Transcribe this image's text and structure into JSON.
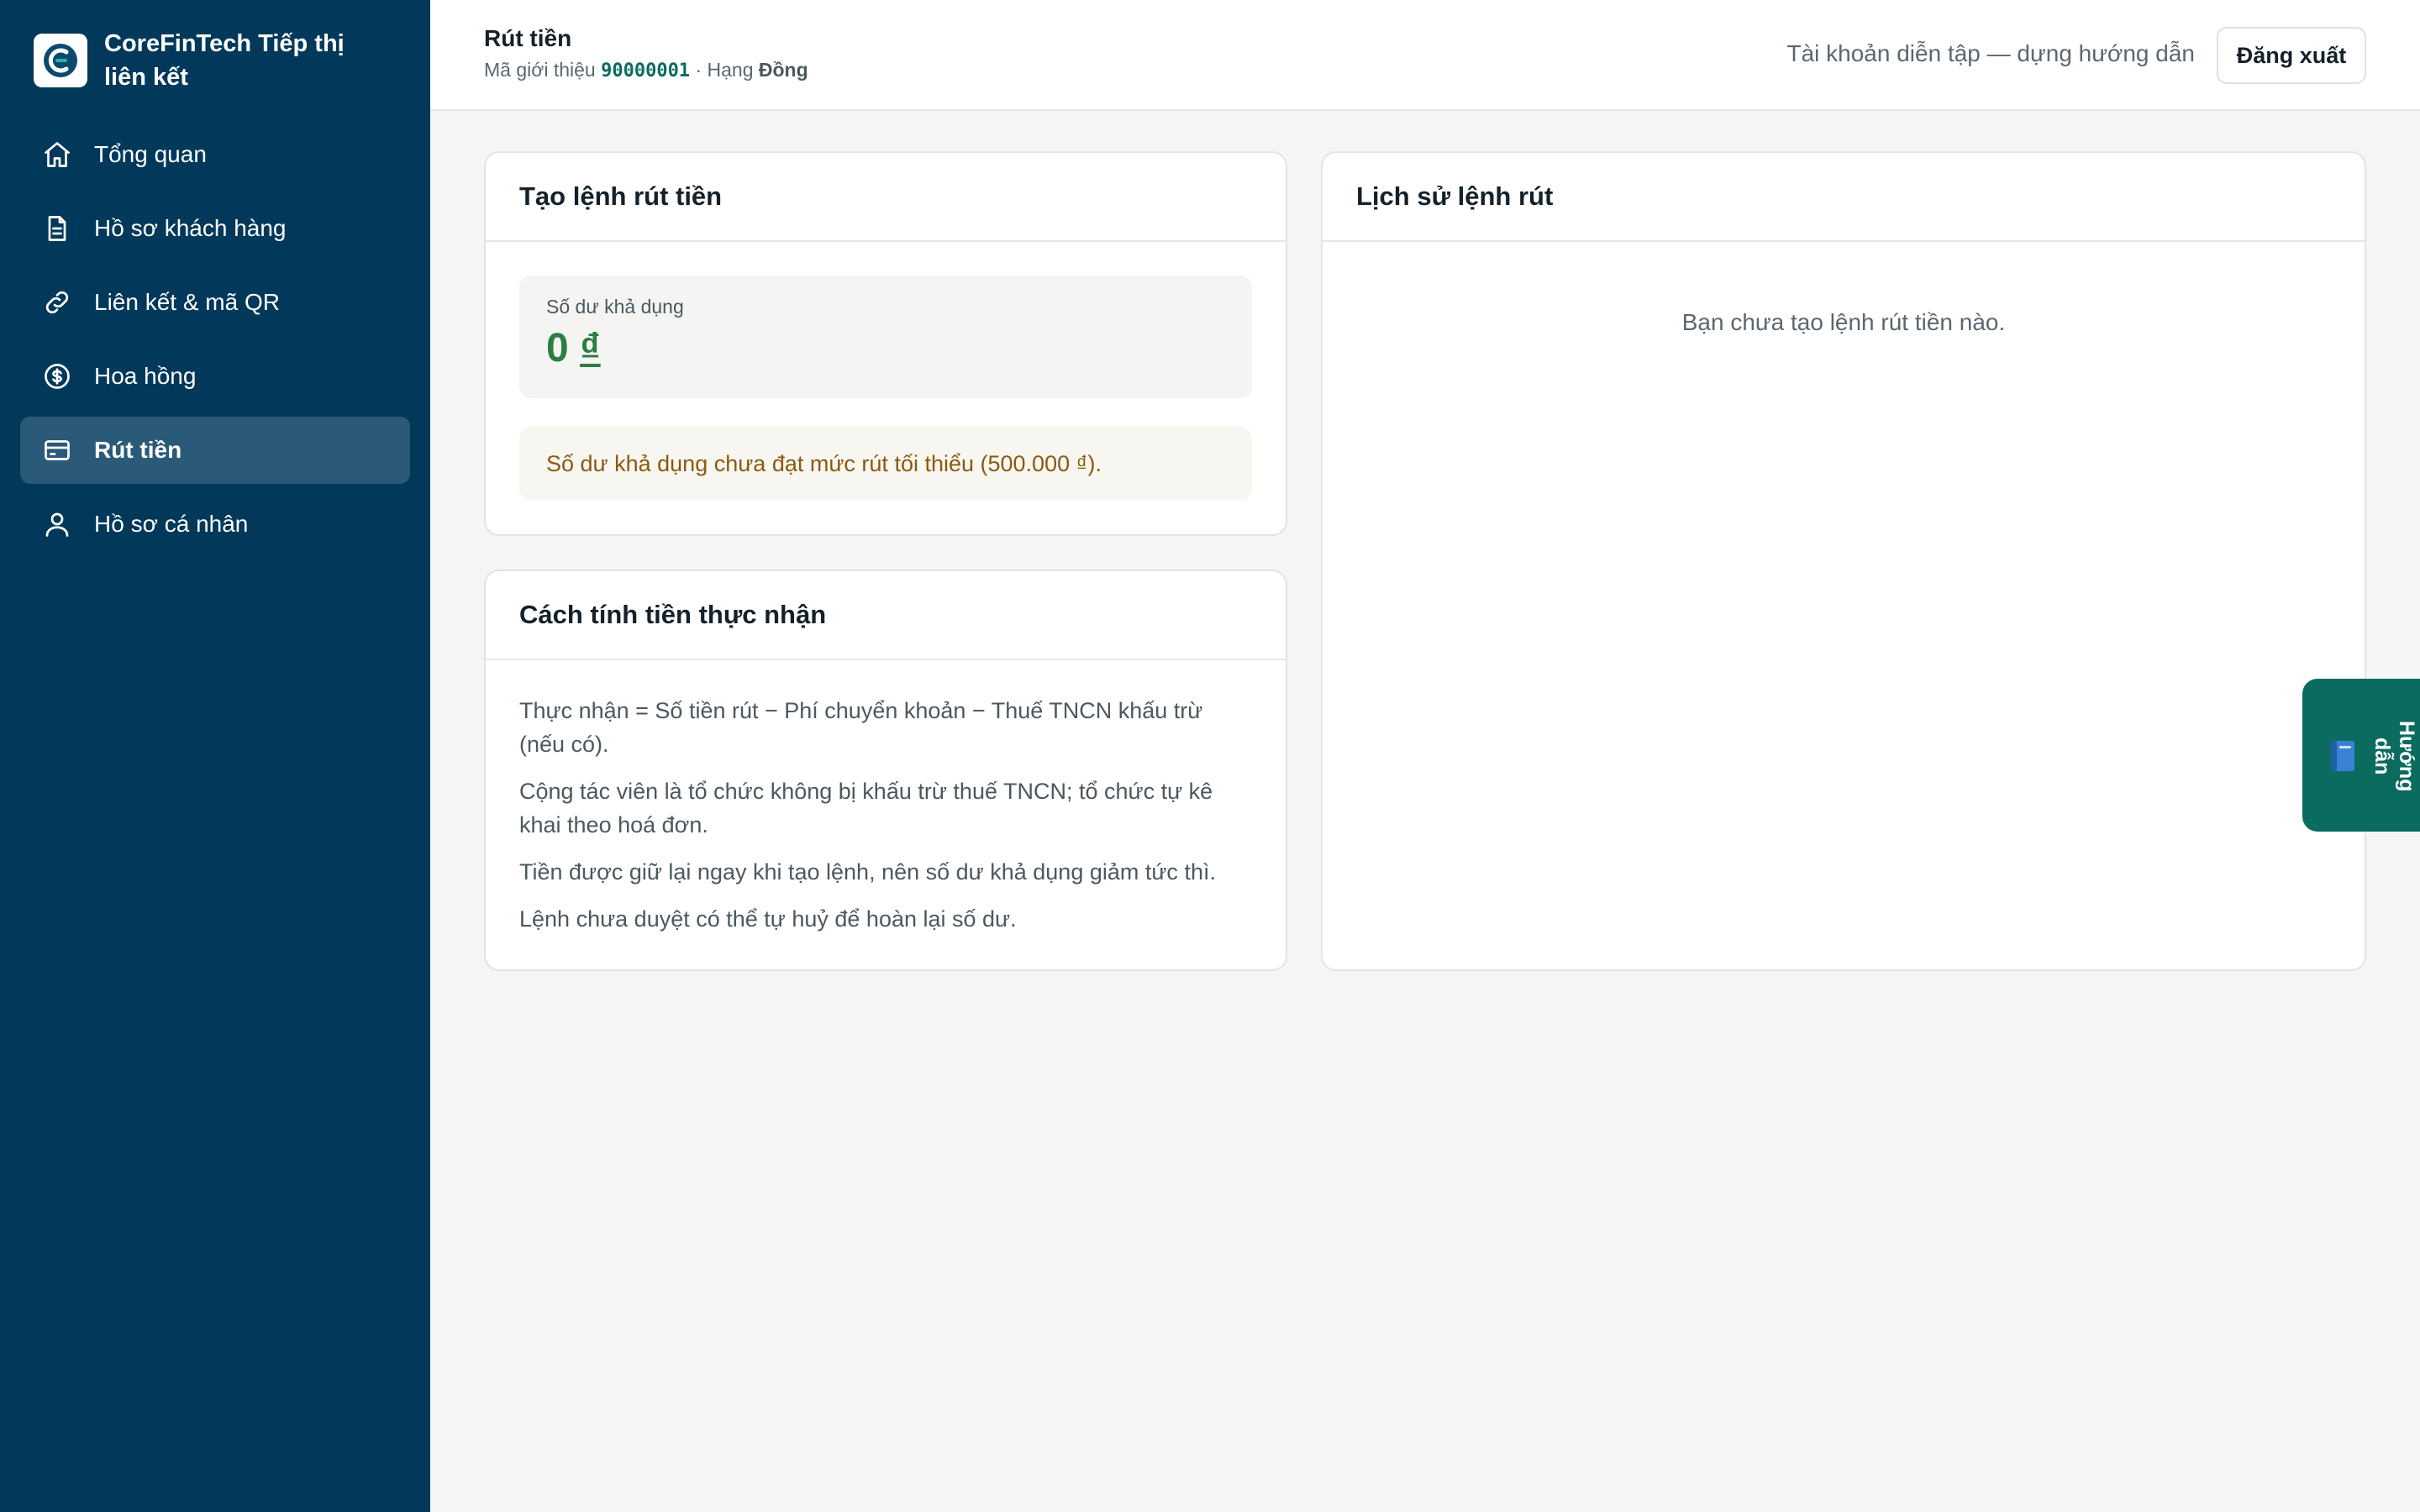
{
  "brand": {
    "name": "CoreFinTech Tiếp thị liên kết",
    "logo_letter": "C"
  },
  "sidebar": {
    "items": [
      {
        "label": "Tổng quan",
        "icon": "home-icon",
        "active": false
      },
      {
        "label": "Hồ sơ khách hàng",
        "icon": "document-icon",
        "active": false
      },
      {
        "label": "Liên kết & mã QR",
        "icon": "link-icon",
        "active": false
      },
      {
        "label": "Hoa hồng",
        "icon": "dollar-icon",
        "active": false
      },
      {
        "label": "Rút tiền",
        "icon": "card-icon",
        "active": true
      },
      {
        "label": "Hồ sơ cá nhân",
        "icon": "user-icon",
        "active": false
      }
    ]
  },
  "header": {
    "title": "Rút tiền",
    "referral_label": "Mã giới thiệu",
    "referral_code": "90000001",
    "rank_label": "· Hạng",
    "rank_value": "Đồng",
    "demo_text": "Tài khoản diễn tập — dựng hướng dẫn",
    "logout_label": "Đăng xuất"
  },
  "create": {
    "title": "Tạo lệnh rút tiền",
    "balance_label": "Số dư khả dụng",
    "balance_amount": "0",
    "balance_currency": "₫",
    "warning": "Số dư khả dụng chưa đạt mức rút tối thiểu (500.000 ₫)."
  },
  "calc": {
    "title": "Cách tính tiền thực nhận",
    "lines": [
      "Thực nhận = Số tiền rút − Phí chuyển khoản − Thuế TNCN khấu trừ (nếu có).",
      "Cộng tác viên là tổ chức không bị khấu trừ thuế TNCN; tổ chức tự kê khai theo hoá đơn.",
      "Tiền được giữ lại ngay khi tạo lệnh, nên số dư khả dụng giảm tức thì.",
      "Lệnh chưa duyệt có thể tự huỷ để hoàn lại số dư."
    ]
  },
  "history": {
    "title": "Lịch sử lệnh rút",
    "empty": "Bạn chưa tạo lệnh rút tiền nào."
  },
  "guide": {
    "label": "Hướng dẫn",
    "icon": "book-icon"
  },
  "colors": {
    "sidebar": "#02395a",
    "sidebar_active": "#2a5a78",
    "accent": "#0a6b5e",
    "balance": "#2e7d43",
    "warning": "#8a5a10"
  }
}
